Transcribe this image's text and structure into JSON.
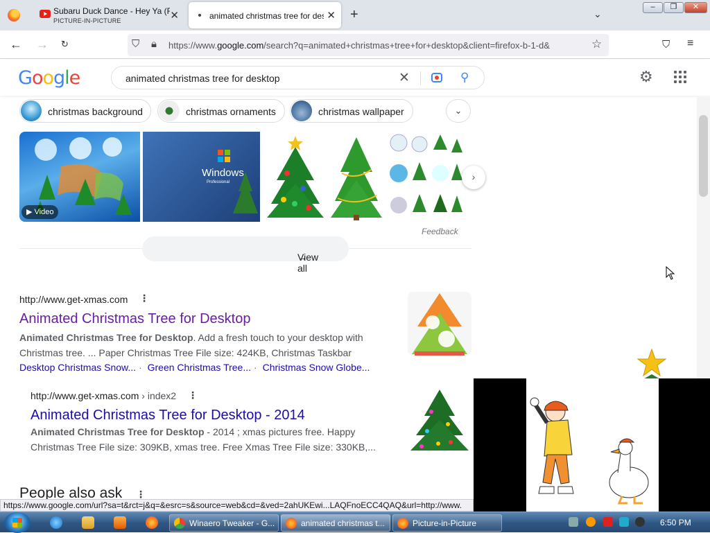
{
  "browser": {
    "tabs": [
      {
        "title": "Subaru Duck Dance - Hey Ya (F",
        "subtitle": "PICTURE-IN-PICTURE"
      },
      {
        "title": "animated christmas tree for des"
      }
    ],
    "url_prefix": "https://www.",
    "url_domain": "google.com",
    "url_rest": "/search?q=animated+christmas+tree+for+desktop&client=firefox-b-1-d&"
  },
  "search": {
    "query": "animated christmas tree for desktop",
    "chips": [
      "christmas background",
      "christmas ornaments",
      "christmas wallpaper"
    ]
  },
  "images": {
    "video_label": "Video",
    "feedback": "Feedback",
    "view_all": "View all",
    "windows_text": "Windows",
    "windows_edition": "Professional"
  },
  "results": [
    {
      "cite": "http://www.get-xmas.com",
      "title": "Animated Christmas Tree for Desktop",
      "snippet_bold": "Animated Christmas Tree for Desktop",
      "snippet_rest": ". Add a fresh touch to your desktop with Christmas tree. ... Paper Christmas Tree File size: 424KB, Christmas Taskbar",
      "sitelinks": [
        "Desktop Christmas Snow...",
        "Green Christmas Tree...",
        "Christmas Snow Globe..."
      ]
    },
    {
      "cite": "http://www.get-xmas.com",
      "cite_path": " › index2",
      "title": "Animated Christmas Tree for Desktop - 2014",
      "snippet_bold": "Animated Christmas Tree for Desktop",
      "snippet_rest": " - 2014 ; xmas pictures free. Happy Christmas Tree File size: 309KB, xmas tree. Free Xmas Tree File size: 330KB,..."
    }
  ],
  "people_also_ask": "People also ask",
  "status_url": "https://www.google.com/url?sa=t&rct=j&q=&esrc=s&source=web&cd=&ved=2ahUKEwi...LAQFnoECC4QAQ&url=http://www.",
  "taskbar": {
    "items": [
      "Winaero Tweaker - G...",
      "animated christmas t...",
      "Picture-in-Picture"
    ],
    "clock": "6:50 PM"
  },
  "colors": {
    "link_visited": "#681da8",
    "link": "#1a0dab",
    "google_blue": "#4285f4",
    "google_red": "#ea4335",
    "google_yellow": "#fbbc05",
    "google_green": "#34a853"
  }
}
